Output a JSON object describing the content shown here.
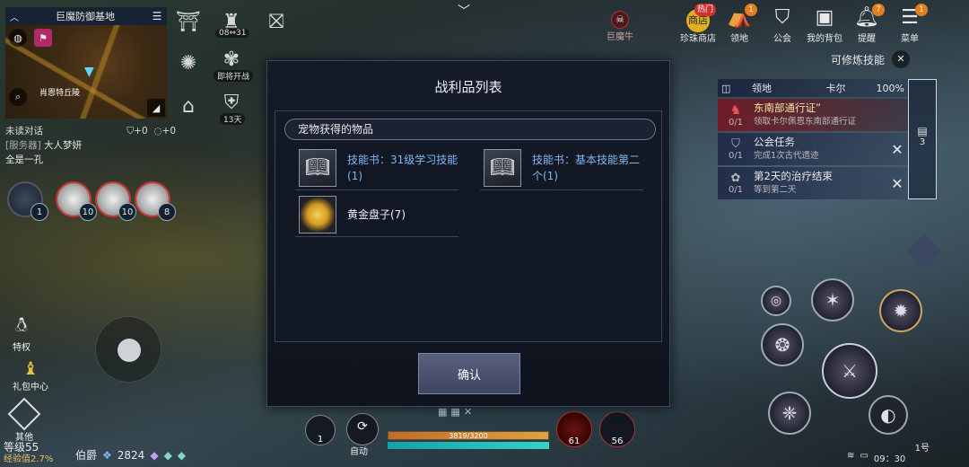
{
  "minimap": {
    "region": "巨魔防御基地",
    "place_label": "肖恩特丘陵"
  },
  "chat": {
    "unread_label": "未读对话",
    "unread_shield_count": "+0",
    "unread_msg_count": "+0",
    "channel": "[服务器]",
    "sender": "大人梦妍",
    "message": "全是一孔"
  },
  "pets": {
    "levels": [
      "1",
      "10",
      "10",
      "8"
    ]
  },
  "top_icons": {
    "event_days": "08⇔31",
    "deputy_label": "即将开战",
    "days_left": "13天"
  },
  "boss": {
    "name": "巨魔牛"
  },
  "top_menu": {
    "shop": {
      "label": "珍珠商店",
      "tag": "热门",
      "badge": ""
    },
    "territory": {
      "label": "领地",
      "badge": "1"
    },
    "guild": {
      "label": "公会",
      "badge": ""
    },
    "bag": {
      "label": "我的背包",
      "badge": ""
    },
    "reminder": {
      "label": "提醒",
      "badge": "7"
    },
    "menu": {
      "label": "菜单",
      "badge": "1"
    }
  },
  "trainable_skills": "可修炼技能",
  "quest": {
    "header_area": "领地",
    "header_name": "卡尔",
    "header_pct": "100%",
    "rows": [
      {
        "progress": "0/1",
        "title": "东南部通行证”",
        "sub": "领取卡尔佩恩东南部通行证"
      },
      {
        "progress": "0/1",
        "title": "公会任务",
        "sub": "完成1次古代遗迹"
      },
      {
        "progress": "0/1",
        "title": "第2天的治疗结束",
        "sub": "等到第二天"
      }
    ],
    "side_count": "3"
  },
  "loot_dialog": {
    "title": "战利品列表",
    "section": "宠物获得的物品",
    "items": [
      {
        "name": "技能书：31级学习技能(1)"
      },
      {
        "name": "技能书：基本技能第二个(1)"
      },
      {
        "name": "黄金盘子(7)"
      }
    ],
    "confirm_label": "确认"
  },
  "left_tools": {
    "privilege": "特权",
    "gift_center": "礼包中心",
    "other": "其他"
  },
  "player": {
    "level": "等级55",
    "exp": "经验值2.7%",
    "title": "伯爵",
    "combat_power": "2824",
    "hp_text": "3819/3200"
  },
  "quickbar": {
    "slot1_count": "1",
    "auto_label": "自动",
    "potion1_count": "61",
    "potion2_count": "56"
  },
  "status": {
    "channel": "1号",
    "time": "09：30"
  }
}
